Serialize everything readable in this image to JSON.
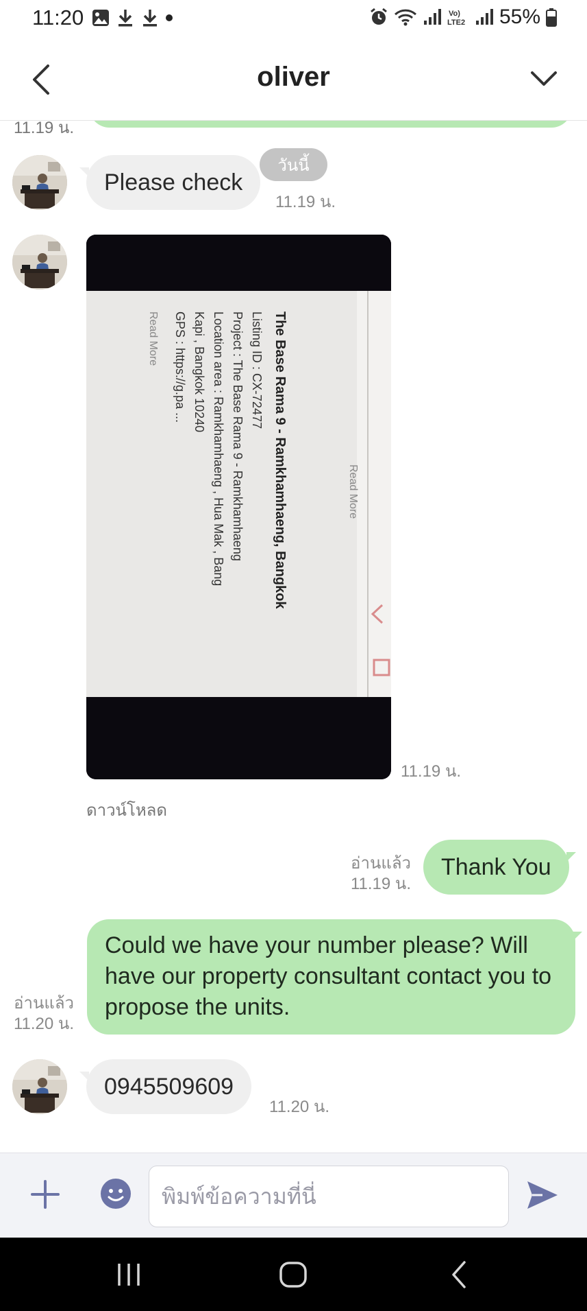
{
  "status_bar": {
    "time": "11:20",
    "battery": "55%"
  },
  "header": {
    "title": "oliver"
  },
  "chat": {
    "previous_time": "11.19 น.",
    "date_separator": "วันนี้",
    "messages": [
      {
        "id": "m1",
        "direction": "incoming",
        "text": "Please check",
        "time": "11.19 น."
      },
      {
        "id": "m2",
        "direction": "incoming",
        "type": "image",
        "time": "11.19 น.",
        "download_label": "ดาวน์โหลด"
      },
      {
        "id": "m3",
        "direction": "outgoing",
        "text": "Thank You",
        "read": "อ่านแล้ว",
        "time": "11.19 น."
      },
      {
        "id": "m4",
        "direction": "outgoing",
        "text": "Could we have your number please? Will have our property consultant contact you to propose the units.",
        "read": "อ่านแล้ว",
        "time": "11.20 น."
      },
      {
        "id": "m5",
        "direction": "incoming",
        "text": "0945509609",
        "time": "11.20 น."
      }
    ],
    "photo_content": {
      "title": "The Base Rama 9 - Ramkhamhaeng, Bangkok",
      "lines": [
        "Listing ID : CX-72477",
        "Project : The Base Rama 9 - Ramkhamhaeng",
        "Location area : Ramkhamhaeng , Hua Mak , Bang",
        "Kapi , Bangkok 10240",
        "GPS : https://g.pa ..."
      ],
      "read_more_1": "Read More",
      "read_more_2": "Read More"
    }
  },
  "input_bar": {
    "placeholder": "พิมพ์ข้อความที่นี่"
  },
  "icons": {
    "back": "chevron-left-icon",
    "menu": "chevron-down-icon",
    "plus": "plus-icon",
    "emoji": "emoji-icon",
    "send": "send-icon"
  },
  "colors": {
    "outgoing_bubble": "#b7e8b3",
    "incoming_bubble": "#efefef",
    "date_chip": "#c4c4c4",
    "accent": "#6b73a6"
  }
}
